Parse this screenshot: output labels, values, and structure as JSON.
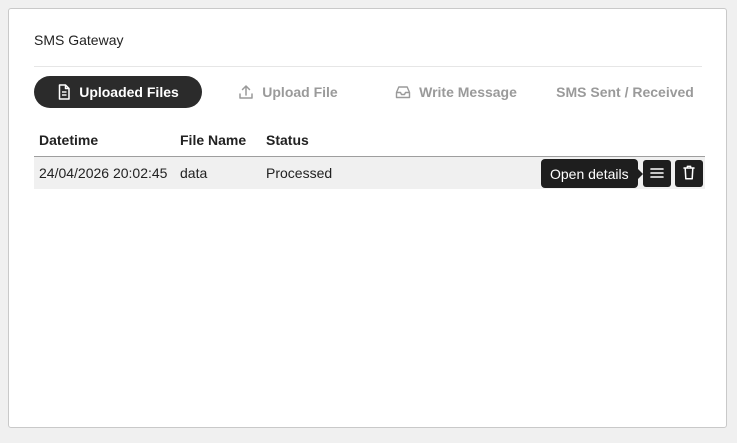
{
  "panel": {
    "title": "SMS Gateway"
  },
  "tabs": [
    {
      "label": "Uploaded Files",
      "icon": "document-icon",
      "active": true
    },
    {
      "label": "Upload File",
      "icon": "upload-icon",
      "active": false
    },
    {
      "label": "Write Message",
      "icon": "inbox-icon",
      "active": false
    },
    {
      "label": "SMS Sent / Received",
      "icon": "",
      "active": false
    }
  ],
  "table": {
    "columns": [
      "Datetime",
      "File Name",
      "Status"
    ],
    "rows": [
      {
        "datetime": "24/04/2026 20:02:45",
        "file_name": "data",
        "status": "Processed"
      }
    ]
  },
  "row_actions": {
    "tooltip": "Open details",
    "details_icon": "menu-icon",
    "delete_icon": "trash-icon"
  },
  "colors": {
    "accent": "#2b2b2b",
    "inactive_tab": "#9a9a9a",
    "row_bg": "#f0f0f0"
  }
}
